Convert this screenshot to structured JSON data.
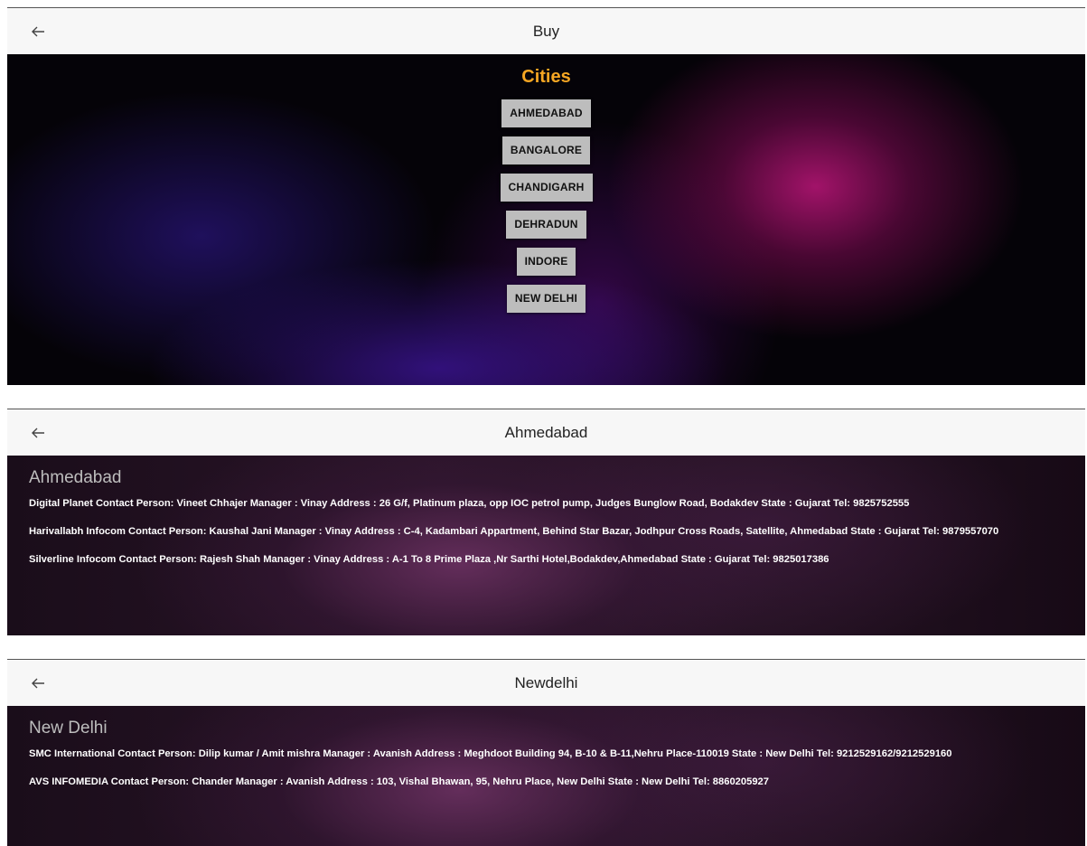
{
  "screens": [
    {
      "appbar": {
        "back_icon": "arrow-left-icon",
        "title": "Buy"
      },
      "heading": "Cities",
      "cities": [
        "AHMEDABAD",
        "BANGALORE",
        "CHANDIGARH",
        "DEHRADUN",
        "INDORE",
        "NEW DELHI"
      ],
      "colors": {
        "heading": "#f5a623",
        "button_bg": "#bdbdbd"
      }
    },
    {
      "appbar": {
        "back_icon": "arrow-left-icon",
        "title": "Ahmedabad"
      },
      "heading": "Ahmedabad",
      "entries": [
        "Digital Planet Contact Person: Vineet Chhajer Manager : Vinay Address : 26 G/f, Platinum plaza, opp IOC petrol pump, Judges Bunglow Road, Bodakdev State : Gujarat Tel: 9825752555",
        "Harivallabh Infocom Contact Person: Kaushal Jani Manager : Vinay Address : C-4, Kadambari Appartment, Behind Star Bazar, Jodhpur Cross Roads, Satellite, Ahmedabad State : Gujarat Tel: 9879557070",
        "Silverline Infocom Contact Person: Rajesh Shah Manager : Vinay Address : A-1 To 8 Prime Plaza ,Nr Sarthi Hotel,Bodakdev,Ahmedabad State : Gujarat Tel: 9825017386"
      ]
    },
    {
      "appbar": {
        "back_icon": "arrow-left-icon",
        "title": "Newdelhi"
      },
      "heading": "New Delhi",
      "entries": [
        "SMC International Contact Person: Dilip kumar / Amit mishra Manager : Avanish Address : Meghdoot Building 94, B-10 & B-11,Nehru Place-110019 State : New Delhi Tel: 9212529162/9212529160",
        "AVS INFOMEDIA Contact Person: Chander Manager : Avanish Address : 103, Vishal Bhawan, 95, Nehru Place, New Delhi State : New Delhi Tel: 8860205927"
      ]
    }
  ]
}
